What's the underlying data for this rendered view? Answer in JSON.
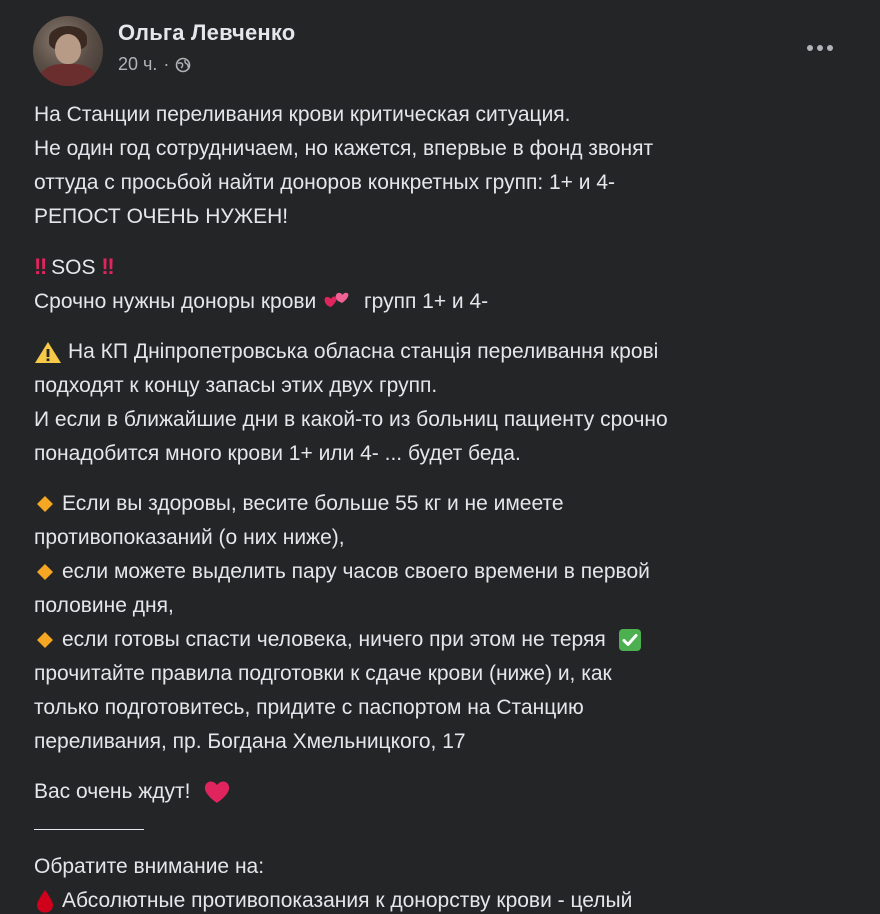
{
  "post": {
    "author": "Ольга Левченко",
    "time": "20 ч.",
    "separator": "·",
    "privacy_icon": "globe-icon",
    "more_icon": "more-options-icon"
  },
  "content": {
    "p1": [
      "На Станции переливания крови критическая ситуация.",
      "Не один год сотрудничаем, но кажется, впервые в фонд звонят",
      "оттуда с просьбой найти доноров конкретных групп: 1+ и 4-",
      "РЕПОСТ ОЧЕНЬ НУЖЕН!"
    ],
    "p2": {
      "sos": "SOS",
      "line2_start": "Срочно нужны доноры крови",
      "line2_end": "групп 1+ и 4-",
      "icons": [
        "double-exclamation-icon",
        "two-hearts-icon"
      ]
    },
    "p3": [
      "На КП Дніпропетровська обласна станція переливання крові",
      "подходят к концу запасы этих двух групп.",
      "И если в ближайшие дни в какой-то из больниц пациенту срочно",
      "понадобится много крови 1+ или 4- ... будет беда."
    ],
    "p4": [
      "Если вы здоровы, весите больше 55 кг и не имеете",
      "противопоказаний (о них ниже),",
      "если можете выделить пару часов своего времени в первой",
      "половине дня,",
      "если готовы спасти человека, ничего при этом не теряя",
      "прочитайте правила подготовки к сдаче крови (ниже) и, как",
      "только подготовитесь, придите с паспортом на Станцию",
      "переливания, пр. Богдана Хмельницкого, 17"
    ],
    "p5": "Вас очень ждут!",
    "notice_title": "Обратите внимание на:",
    "last_line": "Абсолютные противопоказания к донорству крови - целый",
    "colors": {
      "background": "#242526",
      "text": "#e4e6eb",
      "secondary": "#b0b3b8",
      "diamond": "#f5a623",
      "check": "#4caf50",
      "heart": "#e0245e",
      "warning": "#f7c948"
    }
  }
}
